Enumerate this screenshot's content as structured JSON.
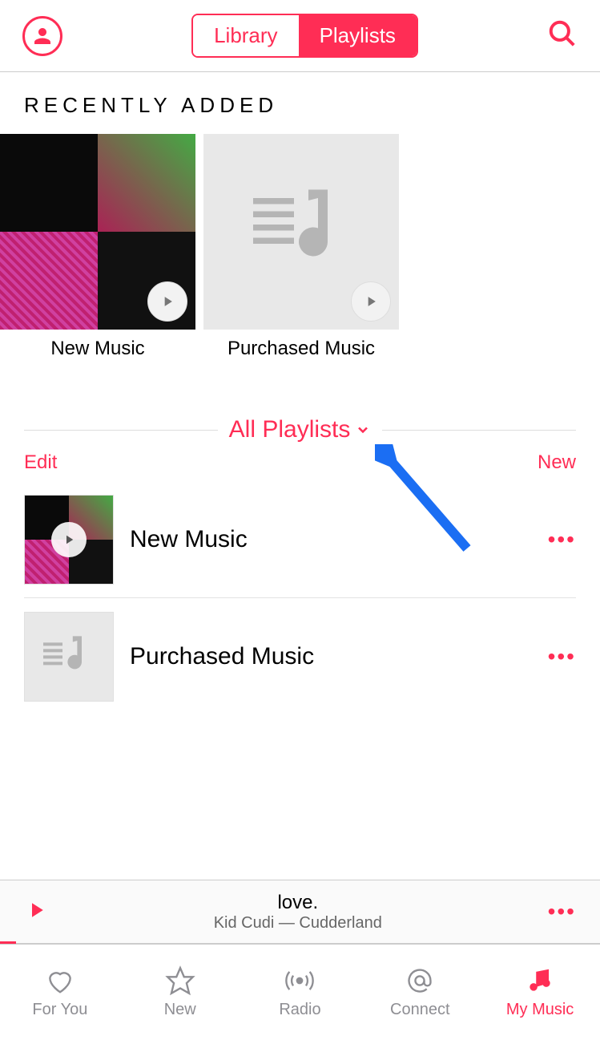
{
  "colors": {
    "accent": "#ff2d55"
  },
  "header": {
    "segments": [
      "Library",
      "Playlists"
    ],
    "selected": 1
  },
  "recently_added": {
    "heading": "RECENTLY ADDED",
    "items": [
      {
        "label": "New Music",
        "icon": "album-quad"
      },
      {
        "label": "Purchased Music",
        "icon": "music-list-placeholder"
      }
    ]
  },
  "filter": {
    "label": "All Playlists",
    "left_action": "Edit",
    "right_action": "New"
  },
  "playlists": [
    {
      "title": "New Music",
      "thumb": "album-quad"
    },
    {
      "title": "Purchased Music",
      "thumb": "music-list-placeholder"
    }
  ],
  "now_playing": {
    "title": "love.",
    "subtitle": "Kid Cudi — Cudderland"
  },
  "tabs": [
    {
      "label": "For You",
      "icon": "heart-icon"
    },
    {
      "label": "New",
      "icon": "star-icon"
    },
    {
      "label": "Radio",
      "icon": "radio-icon"
    },
    {
      "label": "Connect",
      "icon": "at-icon"
    },
    {
      "label": "My Music",
      "icon": "music-note-icon"
    }
  ],
  "active_tab": 4
}
